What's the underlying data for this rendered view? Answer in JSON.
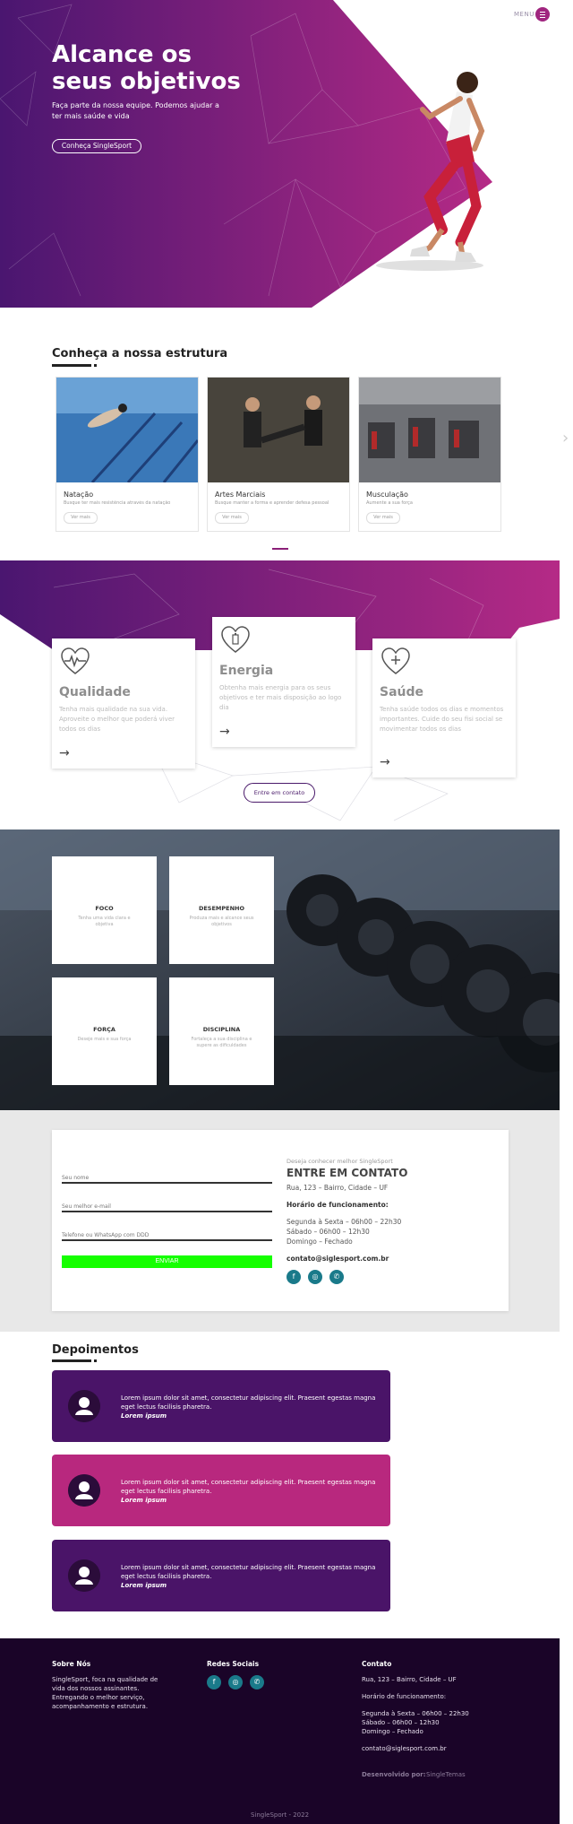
{
  "hero": {
    "title": "Alcance os seus objetivos",
    "subtitle": "Faça parte da nossa equipe. Podemos ajudar a ter mais saúde e vida",
    "button_label": "Conheça SingleSport",
    "menu_label": "MENU"
  },
  "structure": {
    "title": "Conheça a nossa estrutura",
    "cards": [
      {
        "name": "Natação",
        "desc": "Busque ter mais resistência através da natação",
        "button": "Ver mais"
      },
      {
        "name": "Artes Marciais",
        "desc": "Busque manter a forma e aprender defesa pessoal",
        "button": "Ver mais"
      },
      {
        "name": "Musculação",
        "desc": "Aumente a sua força",
        "button": "Ver mais"
      }
    ]
  },
  "features": {
    "items": [
      {
        "title": "Qualidade",
        "text": "Tenha mais qualidade na sua vida. Aproveite o melhor que poderá viver todos os dias"
      },
      {
        "title": "Energia",
        "text": "Obtenha mais energia para os seus objetivos e ter mais disposição ao logo dia"
      },
      {
        "title": "Saúde",
        "text": "Tenha saúde todos os dias e momentos importantes. Cuide do seu fisi social se movimentar todos os dias"
      }
    ],
    "contact_button": "Entre em contato"
  },
  "values": [
    {
      "title": "FOCO",
      "text": "Tenha uma vida clara e objetiva"
    },
    {
      "title": "DESEMPENHO",
      "text": "Produza mais e alcance seus objetivos"
    },
    {
      "title": "FORÇA",
      "text": "Deseje mais e sua força"
    },
    {
      "title": "DISCIPLINA",
      "text": "Fortaleça a sua disciplina e supere as dificuldades"
    }
  ],
  "contact": {
    "name_placeholder": "Seu nome",
    "email_placeholder": "Seu melhor e-mail",
    "phone_placeholder": "Telefone ou WhatsApp com DDD",
    "send_label": "ENVIAR",
    "eyebrow": "Deseja conhecer melhor SingleSport",
    "title": "ENTRE EM CONTATO",
    "address": "Rua, 123 – Bairro, Cidade – UF",
    "hours_title": "Horário de funcionamento:",
    "hours": [
      "Segunda à Sexta – 06h00 – 22h30",
      "Sábado – 06h00 – 12h30",
      "Domingo – Fechado"
    ],
    "email": "contato@siglesport.com.br"
  },
  "testimonials": {
    "title": "Depoimentos",
    "items": [
      {
        "text": "Lorem ipsum dolor sit amet, consectetur adipiscing elit. Praesent egestas magna eget lectus facilisis pharetra.",
        "author": "Lorem ipsum",
        "color": "#4a1468"
      },
      {
        "text": "Lorem ipsum dolor sit amet, consectetur adipiscing elit. Praesent egestas magna eget lectus facilisis pharetra.",
        "author": "Lorem ipsum",
        "color": "#b8287e"
      },
      {
        "text": "Lorem ipsum dolor sit amet, consectetur adipiscing elit. Praesent egestas magna eget lectus facilisis pharetra.",
        "author": "Lorem ipsum",
        "color": "#4a1468"
      }
    ]
  },
  "footer": {
    "about_title": "Sobre Nós",
    "about_text": "SingleSport, foca na qualidade de vida dos nossos assinantes. Entregando o melhor serviço, acompanhamento e estrutura.",
    "social_title": "Redes Sociais",
    "contact_title": "Contato",
    "address": "Rua, 123 – Bairro, Cidade – UF",
    "hours_title": "Horário de funcionamento:",
    "hours": [
      "Segunda à Sexta – 06h00 – 22h30",
      "Sábado – 06h00 – 12h30",
      "Domingo – Fechado"
    ],
    "email": "contato@siglesport.com.br",
    "dev_label": "Desenvolvido por:",
    "dev_name": "SingleTemas",
    "copyright": "SingleSport - 2022"
  },
  "colors": {
    "purple_dark": "#4a1468",
    "magenta": "#b8287e",
    "send_green": "#15ff00",
    "footer_bg": "#1a0428",
    "social_teal": "#1a7a8a"
  }
}
